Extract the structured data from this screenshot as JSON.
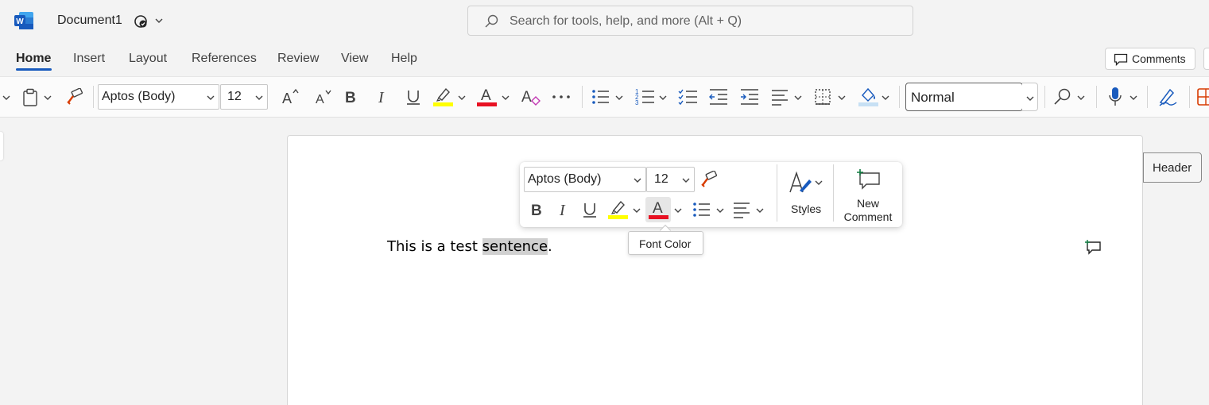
{
  "titlebar": {
    "doc_title": "Document1",
    "search_placeholder": "Search for tools, help, and more (Alt + Q)"
  },
  "tabs": [
    {
      "label": "Home",
      "active": true
    },
    {
      "label": "Insert"
    },
    {
      "label": "Layout"
    },
    {
      "label": "References"
    },
    {
      "label": "Review"
    },
    {
      "label": "View"
    },
    {
      "label": "Help"
    }
  ],
  "comments_label": "Comments",
  "ribbon": {
    "font_name": "Aptos (Body)",
    "font_size": "12",
    "style_name": "Normal",
    "highlight_color": "#ffff00",
    "font_color": "#e81123"
  },
  "page": {
    "header_button": "Header",
    "text_before": "This is a test ",
    "text_selected": "sentence",
    "text_after": "."
  },
  "mini_toolbar": {
    "font_name": "Aptos (Body)",
    "font_size": "12",
    "styles_label": "Styles",
    "new_comment_line1": "New",
    "new_comment_line2": "Comment",
    "tooltip": "Font Color"
  },
  "accent_color": "#185abd"
}
